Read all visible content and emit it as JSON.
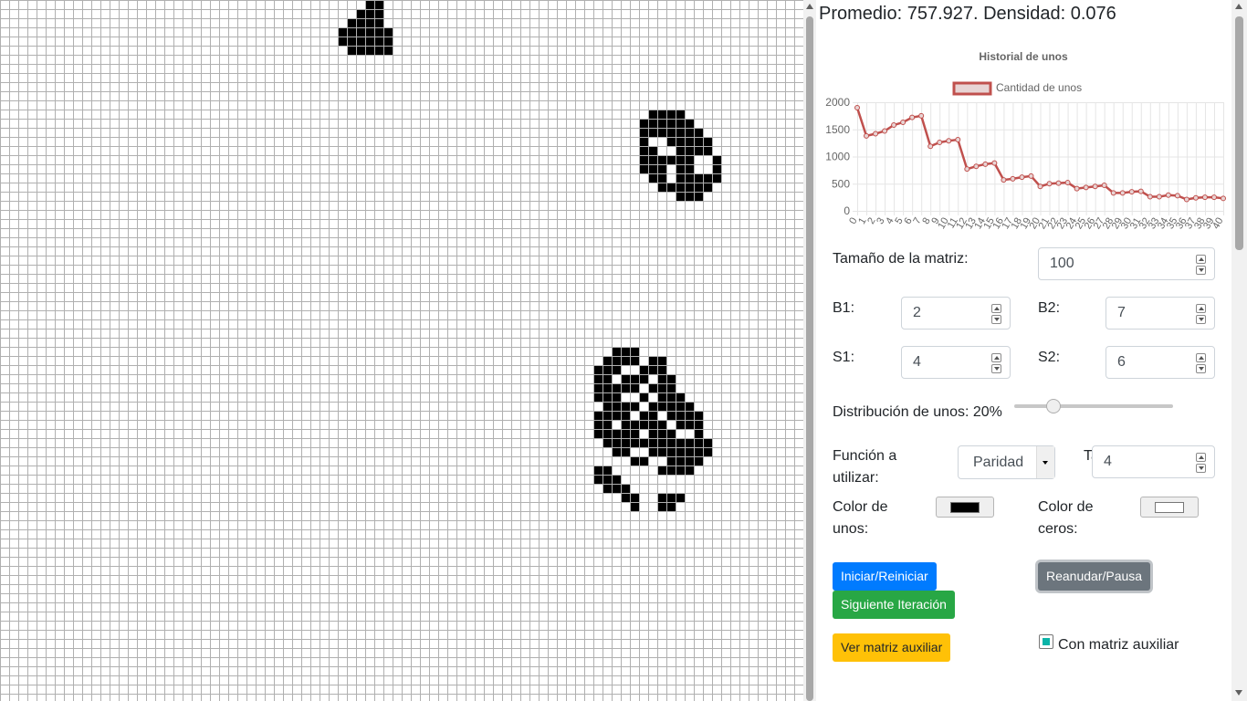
{
  "colors": {
    "grid_line": "#b0b0b0",
    "alive_cell": "#000000",
    "dead_cell": "#ffffff",
    "chart_line": "#c0504d",
    "chart_fill": "#e8d4d4",
    "primary": "#007bff",
    "success": "#28a745",
    "warning": "#ffc107",
    "secondary": "#6c757d"
  },
  "grid": {
    "cols": 88,
    "rows": 77,
    "alive_cells": [
      [
        40,
        0
      ],
      [
        41,
        0
      ],
      [
        39,
        1
      ],
      [
        40,
        1
      ],
      [
        41,
        1
      ],
      [
        38,
        2
      ],
      [
        39,
        2
      ],
      [
        40,
        2
      ],
      [
        41,
        2
      ],
      [
        37,
        3
      ],
      [
        38,
        3
      ],
      [
        39,
        3
      ],
      [
        40,
        3
      ],
      [
        41,
        3
      ],
      [
        42,
        3
      ],
      [
        37,
        4
      ],
      [
        38,
        4
      ],
      [
        39,
        4
      ],
      [
        40,
        4
      ],
      [
        41,
        4
      ],
      [
        42,
        4
      ],
      [
        38,
        5
      ],
      [
        39,
        5
      ],
      [
        40,
        5
      ],
      [
        41,
        5
      ],
      [
        42,
        5
      ],
      [
        71,
        12
      ],
      [
        72,
        12
      ],
      [
        73,
        12
      ],
      [
        74,
        12
      ],
      [
        70,
        13
      ],
      [
        71,
        13
      ],
      [
        72,
        13
      ],
      [
        73,
        13
      ],
      [
        74,
        13
      ],
      [
        75,
        13
      ],
      [
        70,
        14
      ],
      [
        71,
        14
      ],
      [
        72,
        14
      ],
      [
        73,
        14
      ],
      [
        74,
        14
      ],
      [
        75,
        14
      ],
      [
        76,
        14
      ],
      [
        70,
        15
      ],
      [
        73,
        15
      ],
      [
        74,
        15
      ],
      [
        75,
        15
      ],
      [
        76,
        15
      ],
      [
        77,
        15
      ],
      [
        70,
        16
      ],
      [
        71,
        16
      ],
      [
        74,
        16
      ],
      [
        75,
        16
      ],
      [
        76,
        16
      ],
      [
        77,
        16
      ],
      [
        70,
        17
      ],
      [
        71,
        17
      ],
      [
        72,
        17
      ],
      [
        73,
        17
      ],
      [
        74,
        17
      ],
      [
        75,
        17
      ],
      [
        78,
        17
      ],
      [
        70,
        18
      ],
      [
        71,
        18
      ],
      [
        72,
        18
      ],
      [
        74,
        18
      ],
      [
        75,
        18
      ],
      [
        78,
        18
      ],
      [
        71,
        19
      ],
      [
        72,
        19
      ],
      [
        74,
        19
      ],
      [
        75,
        19
      ],
      [
        76,
        19
      ],
      [
        77,
        19
      ],
      [
        78,
        19
      ],
      [
        72,
        20
      ],
      [
        73,
        20
      ],
      [
        74,
        20
      ],
      [
        75,
        20
      ],
      [
        76,
        20
      ],
      [
        77,
        20
      ],
      [
        74,
        21
      ],
      [
        75,
        21
      ],
      [
        76,
        21
      ],
      [
        67,
        38
      ],
      [
        68,
        38
      ],
      [
        69,
        38
      ],
      [
        66,
        39
      ],
      [
        67,
        39
      ],
      [
        68,
        39
      ],
      [
        69,
        39
      ],
      [
        71,
        39
      ],
      [
        72,
        39
      ],
      [
        65,
        40
      ],
      [
        66,
        40
      ],
      [
        67,
        40
      ],
      [
        70,
        40
      ],
      [
        71,
        40
      ],
      [
        72,
        40
      ],
      [
        65,
        41
      ],
      [
        66,
        41
      ],
      [
        68,
        41
      ],
      [
        69,
        41
      ],
      [
        70,
        41
      ],
      [
        72,
        41
      ],
      [
        73,
        41
      ],
      [
        65,
        42
      ],
      [
        66,
        42
      ],
      [
        67,
        42
      ],
      [
        68,
        42
      ],
      [
        69,
        42
      ],
      [
        71,
        42
      ],
      [
        72,
        42
      ],
      [
        73,
        42
      ],
      [
        65,
        43
      ],
      [
        66,
        43
      ],
      [
        67,
        43
      ],
      [
        70,
        43
      ],
      [
        72,
        43
      ],
      [
        73,
        43
      ],
      [
        74,
        43
      ],
      [
        66,
        44
      ],
      [
        67,
        44
      ],
      [
        68,
        44
      ],
      [
        69,
        44
      ],
      [
        71,
        44
      ],
      [
        72,
        44
      ],
      [
        73,
        44
      ],
      [
        74,
        44
      ],
      [
        75,
        44
      ],
      [
        65,
        45
      ],
      [
        66,
        45
      ],
      [
        67,
        45
      ],
      [
        68,
        45
      ],
      [
        70,
        45
      ],
      [
        71,
        45
      ],
      [
        73,
        45
      ],
      [
        74,
        45
      ],
      [
        75,
        45
      ],
      [
        76,
        45
      ],
      [
        65,
        46
      ],
      [
        66,
        46
      ],
      [
        68,
        46
      ],
      [
        69,
        46
      ],
      [
        70,
        46
      ],
      [
        71,
        46
      ],
      [
        72,
        46
      ],
      [
        74,
        46
      ],
      [
        75,
        46
      ],
      [
        76,
        46
      ],
      [
        65,
        47
      ],
      [
        66,
        47
      ],
      [
        67,
        47
      ],
      [
        68,
        47
      ],
      [
        69,
        47
      ],
      [
        71,
        47
      ],
      [
        72,
        47
      ],
      [
        73,
        47
      ],
      [
        76,
        47
      ],
      [
        66,
        48
      ],
      [
        67,
        48
      ],
      [
        68,
        48
      ],
      [
        69,
        48
      ],
      [
        70,
        48
      ],
      [
        71,
        48
      ],
      [
        72,
        48
      ],
      [
        73,
        48
      ],
      [
        74,
        48
      ],
      [
        75,
        48
      ],
      [
        76,
        48
      ],
      [
        77,
        48
      ],
      [
        67,
        49
      ],
      [
        68,
        49
      ],
      [
        71,
        49
      ],
      [
        72,
        49
      ],
      [
        73,
        49
      ],
      [
        74,
        49
      ],
      [
        75,
        49
      ],
      [
        76,
        49
      ],
      [
        77,
        49
      ],
      [
        69,
        50
      ],
      [
        70,
        50
      ],
      [
        73,
        50
      ],
      [
        74,
        50
      ],
      [
        75,
        50
      ],
      [
        76,
        50
      ],
      [
        65,
        51
      ],
      [
        66,
        51
      ],
      [
        72,
        51
      ],
      [
        73,
        51
      ],
      [
        74,
        51
      ],
      [
        75,
        51
      ],
      [
        65,
        52
      ],
      [
        66,
        52
      ],
      [
        67,
        52
      ],
      [
        66,
        53
      ],
      [
        67,
        53
      ],
      [
        68,
        53
      ],
      [
        68,
        54
      ],
      [
        69,
        54
      ],
      [
        72,
        54
      ],
      [
        73,
        54
      ],
      [
        74,
        54
      ],
      [
        69,
        55
      ],
      [
        72,
        55
      ],
      [
        73,
        55
      ]
    ]
  },
  "stats": {
    "text": "Promedio: 757.927. Densidad: 0.076"
  },
  "chart_data": {
    "type": "line",
    "title": "Historial de unos",
    "series": [
      {
        "name": "Cantidad de unos",
        "values": [
          1900,
          1380,
          1420,
          1470,
          1580,
          1630,
          1720,
          1750,
          1190,
          1260,
          1290,
          1310,
          770,
          820,
          860,
          880,
          570,
          590,
          620,
          640,
          450,
          500,
          510,
          520,
          410,
          430,
          450,
          470,
          330,
          330,
          350,
          360,
          260,
          260,
          290,
          280,
          210,
          240,
          250,
          250,
          230
        ]
      }
    ],
    "x": [
      0,
      1,
      2,
      3,
      4,
      5,
      6,
      7,
      8,
      9,
      10,
      11,
      12,
      13,
      14,
      15,
      16,
      17,
      18,
      19,
      20,
      21,
      22,
      23,
      24,
      25,
      26,
      27,
      28,
      29,
      30,
      31,
      32,
      33,
      34,
      35,
      36,
      37,
      38,
      39,
      40
    ],
    "ylim": [
      0,
      2000
    ],
    "yticks": [
      "0",
      "500",
      "1000",
      "1500",
      "2000"
    ],
    "grid": true,
    "legend": "top"
  },
  "form": {
    "size_label": "Tamaño de la matriz:",
    "size_value": "100",
    "b1_label": "B1:",
    "b1_value": "2",
    "b2_label": "B2:",
    "b2_value": "7",
    "s1_label": "S1:",
    "s1_value": "4",
    "s2_label": "S2:",
    "s2_value": "6",
    "dist_label": "Distribución de unos: 20%",
    "dist_fraction": 0.2,
    "func_label_1": "Función a",
    "func_label_2": "utilizar:",
    "func_selected": "Paridad",
    "tau_label": "Tau:",
    "tau_value": "4",
    "color_ones_1": "Color de",
    "color_ones_2": "unos:",
    "color_ones_value": "#000000",
    "color_zeros_1": "Color de",
    "color_zeros_2": "ceros:",
    "color_zeros_value": "#ffffff"
  },
  "buttons": {
    "start": "Iniciar/Reiniciar",
    "resume": "Reanudar/Pausa",
    "next": "Siguiente Iteración",
    "aux": "Ver matriz auxiliar",
    "aux_check_label": "Con matriz auxiliar",
    "aux_checked": true
  }
}
